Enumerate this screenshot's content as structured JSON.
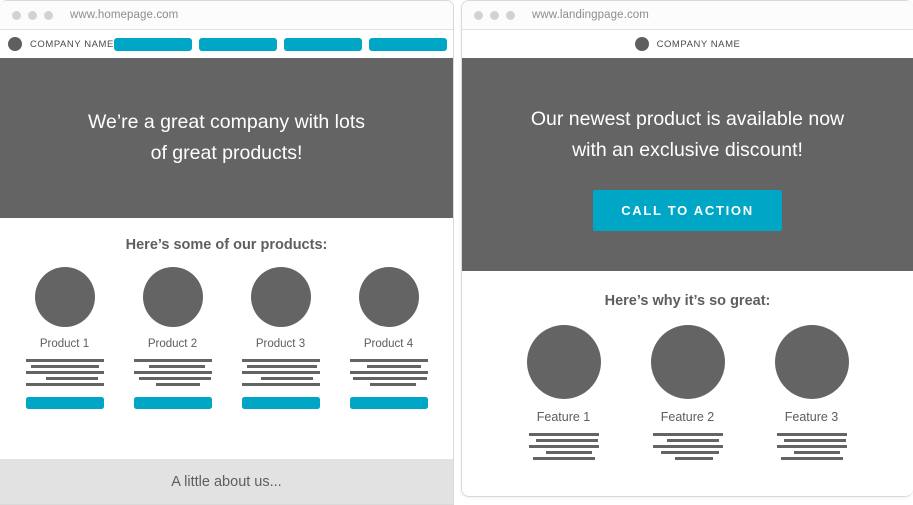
{
  "accent_color": "#00a6c6",
  "gray_color": "#646464",
  "left_window": {
    "chrome": {
      "url": "www.homepage.com",
      "dots": [
        "traffic-light-dot",
        "traffic-light-dot",
        "traffic-light-dot"
      ]
    },
    "navbar": {
      "brand_label": "COMPANY NAME",
      "nav_items": [
        {
          "label": ""
        },
        {
          "label": ""
        },
        {
          "label": ""
        },
        {
          "label": ""
        }
      ]
    },
    "hero": {
      "line1": "We’re a great company with lots",
      "line2": "of great products!"
    },
    "products_section": {
      "heading": "Here’s some of our products:",
      "items": [
        {
          "title": "Product 1",
          "line_widths": [
            78,
            68,
            78,
            52,
            78
          ],
          "line_indents": [
            0,
            0,
            0,
            14,
            0
          ],
          "button_label": ""
        },
        {
          "title": "Product 2",
          "line_widths": [
            78,
            56,
            78,
            72,
            44
          ],
          "line_indents": [
            0,
            8,
            0,
            4,
            10
          ],
          "button_label": ""
        },
        {
          "title": "Product 3",
          "line_widths": [
            78,
            70,
            78,
            52,
            78
          ],
          "line_indents": [
            0,
            2,
            0,
            12,
            0
          ],
          "button_label": ""
        },
        {
          "title": "Product 4",
          "line_widths": [
            78,
            54,
            78,
            74,
            46
          ],
          "line_indents": [
            0,
            10,
            0,
            2,
            8
          ],
          "button_label": ""
        }
      ]
    },
    "footer": {
      "text": "A little about us..."
    }
  },
  "right_window": {
    "chrome": {
      "url": "www.landingpage.com",
      "dots": [
        "traffic-light-dot",
        "traffic-light-dot",
        "traffic-light-dot"
      ]
    },
    "navbar": {
      "brand_label": "COMPANY NAME"
    },
    "hero": {
      "line1": "Our newest product is available now",
      "line2": "with an exclusive discount!",
      "cta_label": "CALL TO ACTION"
    },
    "features_section": {
      "heading": "Here’s why it’s so great:",
      "items": [
        {
          "title": "Feature 1",
          "line_widths": [
            70,
            62,
            70,
            46,
            62
          ],
          "line_indents": [
            0,
            6,
            0,
            10,
            0
          ]
        },
        {
          "title": "Feature 2",
          "line_widths": [
            70,
            52,
            70,
            58,
            38
          ],
          "line_indents": [
            0,
            10,
            0,
            4,
            12
          ]
        },
        {
          "title": "Feature 3",
          "line_widths": [
            70,
            62,
            70,
            46,
            62
          ],
          "line_indents": [
            0,
            6,
            0,
            10,
            0
          ]
        }
      ]
    }
  }
}
